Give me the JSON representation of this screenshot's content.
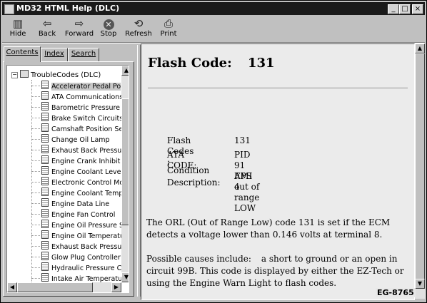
{
  "window": {
    "title": "MD32 HTML Help (DLC)",
    "controls": {
      "minimize": "_",
      "maximize": "□",
      "close": "×"
    }
  },
  "toolbar": {
    "buttons": [
      {
        "label": "Hide",
        "icon": "hide-icon"
      },
      {
        "label": "Back",
        "icon": "back-arrow-icon"
      },
      {
        "label": "Forward",
        "icon": "forward-arrow-icon"
      },
      {
        "label": "Stop",
        "icon": "stop-icon"
      },
      {
        "label": "Refresh",
        "icon": "refresh-icon"
      },
      {
        "label": "Print",
        "icon": "printer-icon"
      }
    ]
  },
  "navigation": {
    "tabs": [
      {
        "label": "Contents",
        "active": true
      },
      {
        "label": "Index",
        "active": false
      },
      {
        "label": "Search",
        "active": false
      }
    ],
    "tree": {
      "root": "TroubleCodes (DLC)",
      "items": [
        "Accelerator Pedal Po",
        "ATA Communications",
        "Barometric Pressure",
        "Brake Switch Circuits",
        "Camshaft Position Se",
        "Change Oil Lamp",
        "Exhaust Back Pressu",
        "Engine Crank Inhibit",
        "Engine Coolant Level",
        "Electronic Control Mo",
        "Engine Coolant Temp",
        "Engine Data Line",
        "Engine Fan Control",
        "Engine Oil Pressure S",
        "Engine Oil Temperatu",
        "Exhaust Back Pressu",
        "Glow Plug Controller",
        "Hydraulic Pressure C",
        "Intake Air Temperatu"
      ],
      "selected_index": 0
    }
  },
  "content": {
    "title_label": "Flash Code:",
    "title_code": "131",
    "fields": [
      {
        "label": "Flash Codes :",
        "value": "131"
      },
      {
        "label": "ATA CODE:",
        "value": "PID 91 FMI 4"
      },
      {
        "label": "Condition",
        "value": "APS out of range LOW"
      },
      {
        "label": "Description:",
        "value": ""
      }
    ],
    "paragraph1": "The ORL (Out of Range Low) code 131 is set if the ECM detects a voltage lower than 0.146 volts at terminal 8.",
    "paragraph2_lead": "Possible causes include:",
    "paragraph2_rest": "a short to ground or an open in circuit 99B. This code is displayed by either the EZ-Tech or using the Engine Warn Light to flash codes."
  },
  "figure_label": "EG-8765"
}
